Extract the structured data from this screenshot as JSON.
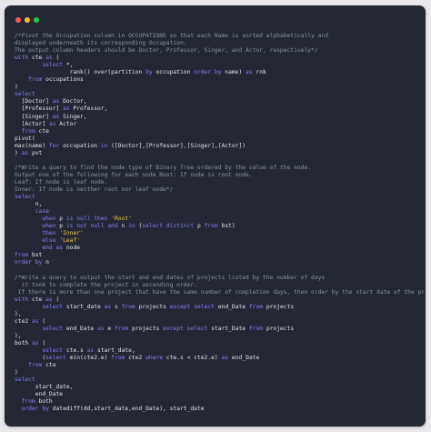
{
  "window": {
    "controls": [
      {
        "name": "close-button",
        "color": "#ff5f56"
      },
      {
        "name": "minimize-button",
        "color": "#ffbd2e"
      },
      {
        "name": "maximize-button",
        "color": "#27c93f"
      }
    ]
  },
  "editor": {
    "lines": [
      [
        {
          "t": "c",
          "v": "/*Pivot the Occupation column in OCCUPATIONS so that each Name is sorted alphabetically and"
        }
      ],
      [
        {
          "t": "c",
          "v": "displayed underneath its corresponding Occupation."
        }
      ],
      [
        {
          "t": "c",
          "v": "The output column headers should be Doctor, Professor, Singer, and Actor, respectively*/"
        }
      ],
      [
        {
          "t": "k",
          "v": "with"
        },
        {
          "t": "p",
          "v": " cte "
        },
        {
          "t": "k",
          "v": "as"
        },
        {
          "t": "p",
          "v": " ("
        }
      ],
      [
        {
          "t": "p",
          "v": "        "
        },
        {
          "t": "k",
          "v": "select"
        },
        {
          "t": "p",
          "v": " *,"
        }
      ],
      [
        {
          "t": "p",
          "v": "                rank() over(partition "
        },
        {
          "t": "k",
          "v": "by"
        },
        {
          "t": "p",
          "v": " occupation "
        },
        {
          "t": "k",
          "v": "order by"
        },
        {
          "t": "p",
          "v": " name) "
        },
        {
          "t": "k",
          "v": "as"
        },
        {
          "t": "p",
          "v": " rnk"
        }
      ],
      [
        {
          "t": "p",
          "v": "    "
        },
        {
          "t": "k",
          "v": "from"
        },
        {
          "t": "p",
          "v": " occupations"
        }
      ],
      [
        {
          "t": "p",
          "v": ")"
        }
      ],
      [
        {
          "t": "k",
          "v": "select"
        }
      ],
      [
        {
          "t": "p",
          "v": "  [Doctor] "
        },
        {
          "t": "k",
          "v": "as"
        },
        {
          "t": "p",
          "v": " Doctor,"
        }
      ],
      [
        {
          "t": "p",
          "v": "  [Professor] "
        },
        {
          "t": "k",
          "v": "as"
        },
        {
          "t": "p",
          "v": " Professor,"
        }
      ],
      [
        {
          "t": "p",
          "v": "  [Singer] "
        },
        {
          "t": "k",
          "v": "as"
        },
        {
          "t": "p",
          "v": " Singer,"
        }
      ],
      [
        {
          "t": "p",
          "v": "  [Actor] "
        },
        {
          "t": "k",
          "v": "as"
        },
        {
          "t": "p",
          "v": " Actor"
        }
      ],
      [
        {
          "t": "p",
          "v": "  "
        },
        {
          "t": "k",
          "v": "from"
        },
        {
          "t": "p",
          "v": " cte"
        }
      ],
      [
        {
          "t": "p",
          "v": "pivot("
        }
      ],
      [
        {
          "t": "p",
          "v": "max(name) "
        },
        {
          "t": "k",
          "v": "for"
        },
        {
          "t": "p",
          "v": " occupation "
        },
        {
          "t": "k",
          "v": "in"
        },
        {
          "t": "p",
          "v": " ([Doctor],[Professor],[Singer],[Actor])"
        }
      ],
      [
        {
          "t": "p",
          "v": ") "
        },
        {
          "t": "k",
          "v": "as"
        },
        {
          "t": "p",
          "v": " pvt"
        }
      ],
      [
        {
          "t": "p",
          "v": ""
        }
      ],
      [
        {
          "t": "c",
          "v": "/*Write a query to find the node type of Binary Tree ordered by the value of the node."
        }
      ],
      [
        {
          "t": "c",
          "v": "Output one of the following for each node Root: If node is root node."
        }
      ],
      [
        {
          "t": "c",
          "v": "Leaf: If node is leaf node."
        }
      ],
      [
        {
          "t": "c",
          "v": "Inner: If node is neither root nor leaf node*/"
        }
      ],
      [
        {
          "t": "k",
          "v": "select"
        }
      ],
      [
        {
          "t": "p",
          "v": "      n,"
        }
      ],
      [
        {
          "t": "p",
          "v": "      "
        },
        {
          "t": "k",
          "v": "case"
        }
      ],
      [
        {
          "t": "p",
          "v": "        "
        },
        {
          "t": "k",
          "v": "when"
        },
        {
          "t": "p",
          "v": " p "
        },
        {
          "t": "k",
          "v": "is null then"
        },
        {
          "t": "p",
          "v": " "
        },
        {
          "t": "s",
          "v": "'Root'"
        }
      ],
      [
        {
          "t": "p",
          "v": "        "
        },
        {
          "t": "k",
          "v": "when"
        },
        {
          "t": "p",
          "v": " p "
        },
        {
          "t": "k",
          "v": "is not null and"
        },
        {
          "t": "p",
          "v": " n "
        },
        {
          "t": "k",
          "v": "in"
        },
        {
          "t": "p",
          "v": " ("
        },
        {
          "t": "k",
          "v": "select distinct"
        },
        {
          "t": "p",
          "v": " p "
        },
        {
          "t": "k",
          "v": "from"
        },
        {
          "t": "p",
          "v": " bst)"
        }
      ],
      [
        {
          "t": "p",
          "v": "        "
        },
        {
          "t": "k",
          "v": "then"
        },
        {
          "t": "p",
          "v": " "
        },
        {
          "t": "s",
          "v": "'Inner'"
        }
      ],
      [
        {
          "t": "p",
          "v": "        "
        },
        {
          "t": "k",
          "v": "else"
        },
        {
          "t": "p",
          "v": " "
        },
        {
          "t": "s",
          "v": "'Leaf'"
        }
      ],
      [
        {
          "t": "p",
          "v": "        "
        },
        {
          "t": "k",
          "v": "end as"
        },
        {
          "t": "p",
          "v": " node"
        }
      ],
      [
        {
          "t": "k",
          "v": "from"
        },
        {
          "t": "p",
          "v": " bst"
        }
      ],
      [
        {
          "t": "k",
          "v": "order by"
        },
        {
          "t": "p",
          "v": " n"
        }
      ],
      [
        {
          "t": "p",
          "v": ""
        }
      ],
      [
        {
          "t": "c",
          "v": "/*Write a query to output the start and end dates of projects listed by the number of days"
        }
      ],
      [
        {
          "t": "c",
          "v": "  it took to complete the project in ascending order."
        }
      ],
      [
        {
          "t": "c",
          "v": " If there is more than one project that have the same number of completion days, then order by the start date of the project*/"
        }
      ],
      [
        {
          "t": "k",
          "v": "with"
        },
        {
          "t": "p",
          "v": " cte "
        },
        {
          "t": "k",
          "v": "as"
        },
        {
          "t": "p",
          "v": " ("
        }
      ],
      [
        {
          "t": "p",
          "v": "        "
        },
        {
          "t": "k",
          "v": "select"
        },
        {
          "t": "p",
          "v": " start_date "
        },
        {
          "t": "k",
          "v": "as"
        },
        {
          "t": "p",
          "v": " s "
        },
        {
          "t": "k",
          "v": "from"
        },
        {
          "t": "p",
          "v": " projects "
        },
        {
          "t": "k",
          "v": "except select"
        },
        {
          "t": "p",
          "v": " end_Date "
        },
        {
          "t": "k",
          "v": "from"
        },
        {
          "t": "p",
          "v": " projects"
        }
      ],
      [
        {
          "t": "p",
          "v": "),"
        }
      ],
      [
        {
          "t": "p",
          "v": "cte2 "
        },
        {
          "t": "k",
          "v": "as"
        },
        {
          "t": "p",
          "v": " ("
        }
      ],
      [
        {
          "t": "p",
          "v": "        "
        },
        {
          "t": "k",
          "v": "select"
        },
        {
          "t": "p",
          "v": " end_Date "
        },
        {
          "t": "k",
          "v": "as"
        },
        {
          "t": "p",
          "v": " e "
        },
        {
          "t": "k",
          "v": "from"
        },
        {
          "t": "p",
          "v": " projects "
        },
        {
          "t": "k",
          "v": "except select"
        },
        {
          "t": "p",
          "v": " start_Date "
        },
        {
          "t": "k",
          "v": "from"
        },
        {
          "t": "p",
          "v": " projects"
        }
      ],
      [
        {
          "t": "p",
          "v": "),"
        }
      ],
      [
        {
          "t": "p",
          "v": "both "
        },
        {
          "t": "k",
          "v": "as"
        },
        {
          "t": "p",
          "v": " ("
        }
      ],
      [
        {
          "t": "p",
          "v": "        "
        },
        {
          "t": "k",
          "v": "select"
        },
        {
          "t": "p",
          "v": " cte.s "
        },
        {
          "t": "k",
          "v": "as"
        },
        {
          "t": "p",
          "v": " start_date,"
        }
      ],
      [
        {
          "t": "p",
          "v": "        ("
        },
        {
          "t": "k",
          "v": "select"
        },
        {
          "t": "p",
          "v": " min(cte2.e) "
        },
        {
          "t": "k",
          "v": "from"
        },
        {
          "t": "p",
          "v": " cte2 "
        },
        {
          "t": "k",
          "v": "where"
        },
        {
          "t": "p",
          "v": " cte.s < cte2.e) "
        },
        {
          "t": "k",
          "v": "as"
        },
        {
          "t": "p",
          "v": " end_Date"
        }
      ],
      [
        {
          "t": "p",
          "v": "    "
        },
        {
          "t": "k",
          "v": "from"
        },
        {
          "t": "p",
          "v": " cte"
        }
      ],
      [
        {
          "t": "p",
          "v": ")"
        }
      ],
      [
        {
          "t": "k",
          "v": "select"
        }
      ],
      [
        {
          "t": "p",
          "v": "      start_date,"
        }
      ],
      [
        {
          "t": "p",
          "v": "      end_Date"
        }
      ],
      [
        {
          "t": "p",
          "v": "  "
        },
        {
          "t": "k",
          "v": "from"
        },
        {
          "t": "p",
          "v": " both"
        }
      ],
      [
        {
          "t": "p",
          "v": "  "
        },
        {
          "t": "k",
          "v": "order by"
        },
        {
          "t": "p",
          "v": " datediff(dd,start_date,end_Date), start_date"
        }
      ]
    ]
  }
}
